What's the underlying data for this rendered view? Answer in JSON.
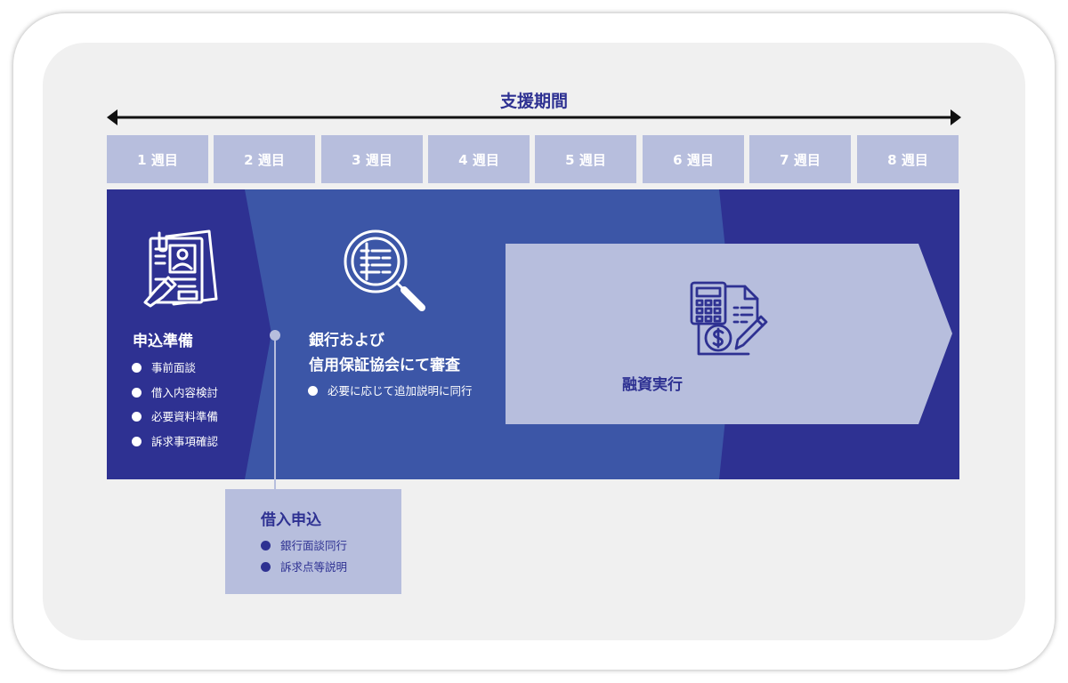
{
  "support_period": {
    "label": "支援期間"
  },
  "weeks": [
    "1 週目",
    "2 週目",
    "3 週目",
    "4 週目",
    "5 週目",
    "6 週目",
    "7 週目",
    "8 週目"
  ],
  "phase1": {
    "title": "申込準備",
    "items": [
      "事前面談",
      "借入内容検討",
      "必要資料準備",
      "訴求事項確認"
    ],
    "icon": "application-document-icon"
  },
  "phase2": {
    "title_line1": "銀行および",
    "title_line2": "信用保証協会にて審査",
    "items": [
      "必要に応じて追加説明に同行"
    ],
    "icon": "magnifier-document-icon"
  },
  "loan_application": {
    "title": "借入申込",
    "items": [
      "銀行面談同行",
      "訴求点等説明"
    ]
  },
  "phase3": {
    "title": "融資実行",
    "icon": "calculator-invoice-icon"
  },
  "colors": {
    "dark_navy": "#2e3192",
    "mid_blue": "#3c56a7",
    "light_lavender": "#b7bedd",
    "background": "#f0f0f0"
  }
}
